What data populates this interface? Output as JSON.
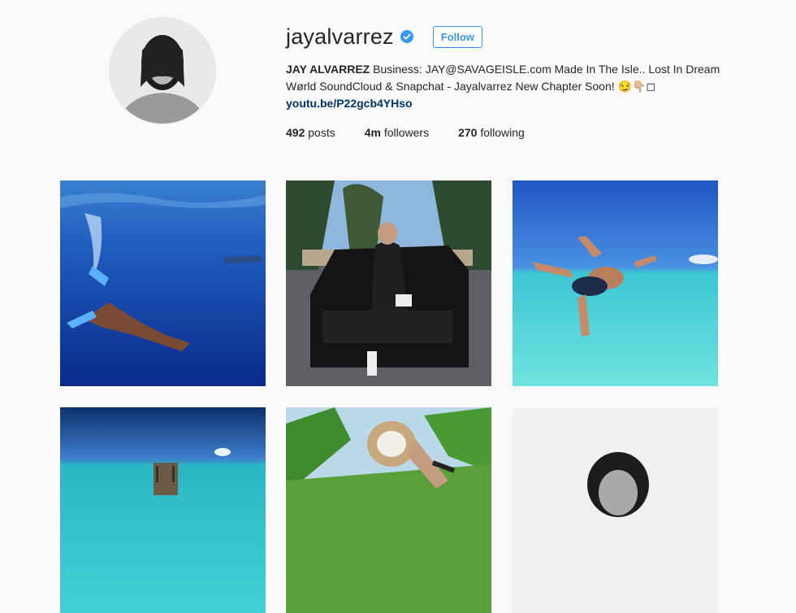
{
  "profile": {
    "username": "jayalvarrez",
    "follow_label": "Follow",
    "full_name": "JAY ALVARREZ",
    "bio_text": " Business: JAY@SAVAGEISLE.com Made In The Isle.. Lost In Dream Wørld SoundCloud & Snapchat - Jayalvarrez New Chapter Soon! 😏👇🏼◻",
    "link": "youtu.be/P22gcb4YHso",
    "avatar_icon": "profile-photo",
    "verified_icon": "verified-badge-icon"
  },
  "stats": {
    "posts_count": "492",
    "posts_label": " posts",
    "followers_count": "4m",
    "followers_label": " followers",
    "following_count": "270",
    "following_label": " following"
  },
  "colors": {
    "accent": "#3897f0",
    "link": "#003569",
    "background": "#fafafa"
  },
  "posts": [
    {
      "subject": "underwater-swimmer-shark"
    },
    {
      "subject": "man-on-black-suv-palms"
    },
    {
      "subject": "man-jumping-turquoise-water"
    },
    {
      "subject": "dock-ocean"
    },
    {
      "subject": "coconut-palms"
    },
    {
      "subject": "portrait-curly-hair"
    }
  ]
}
